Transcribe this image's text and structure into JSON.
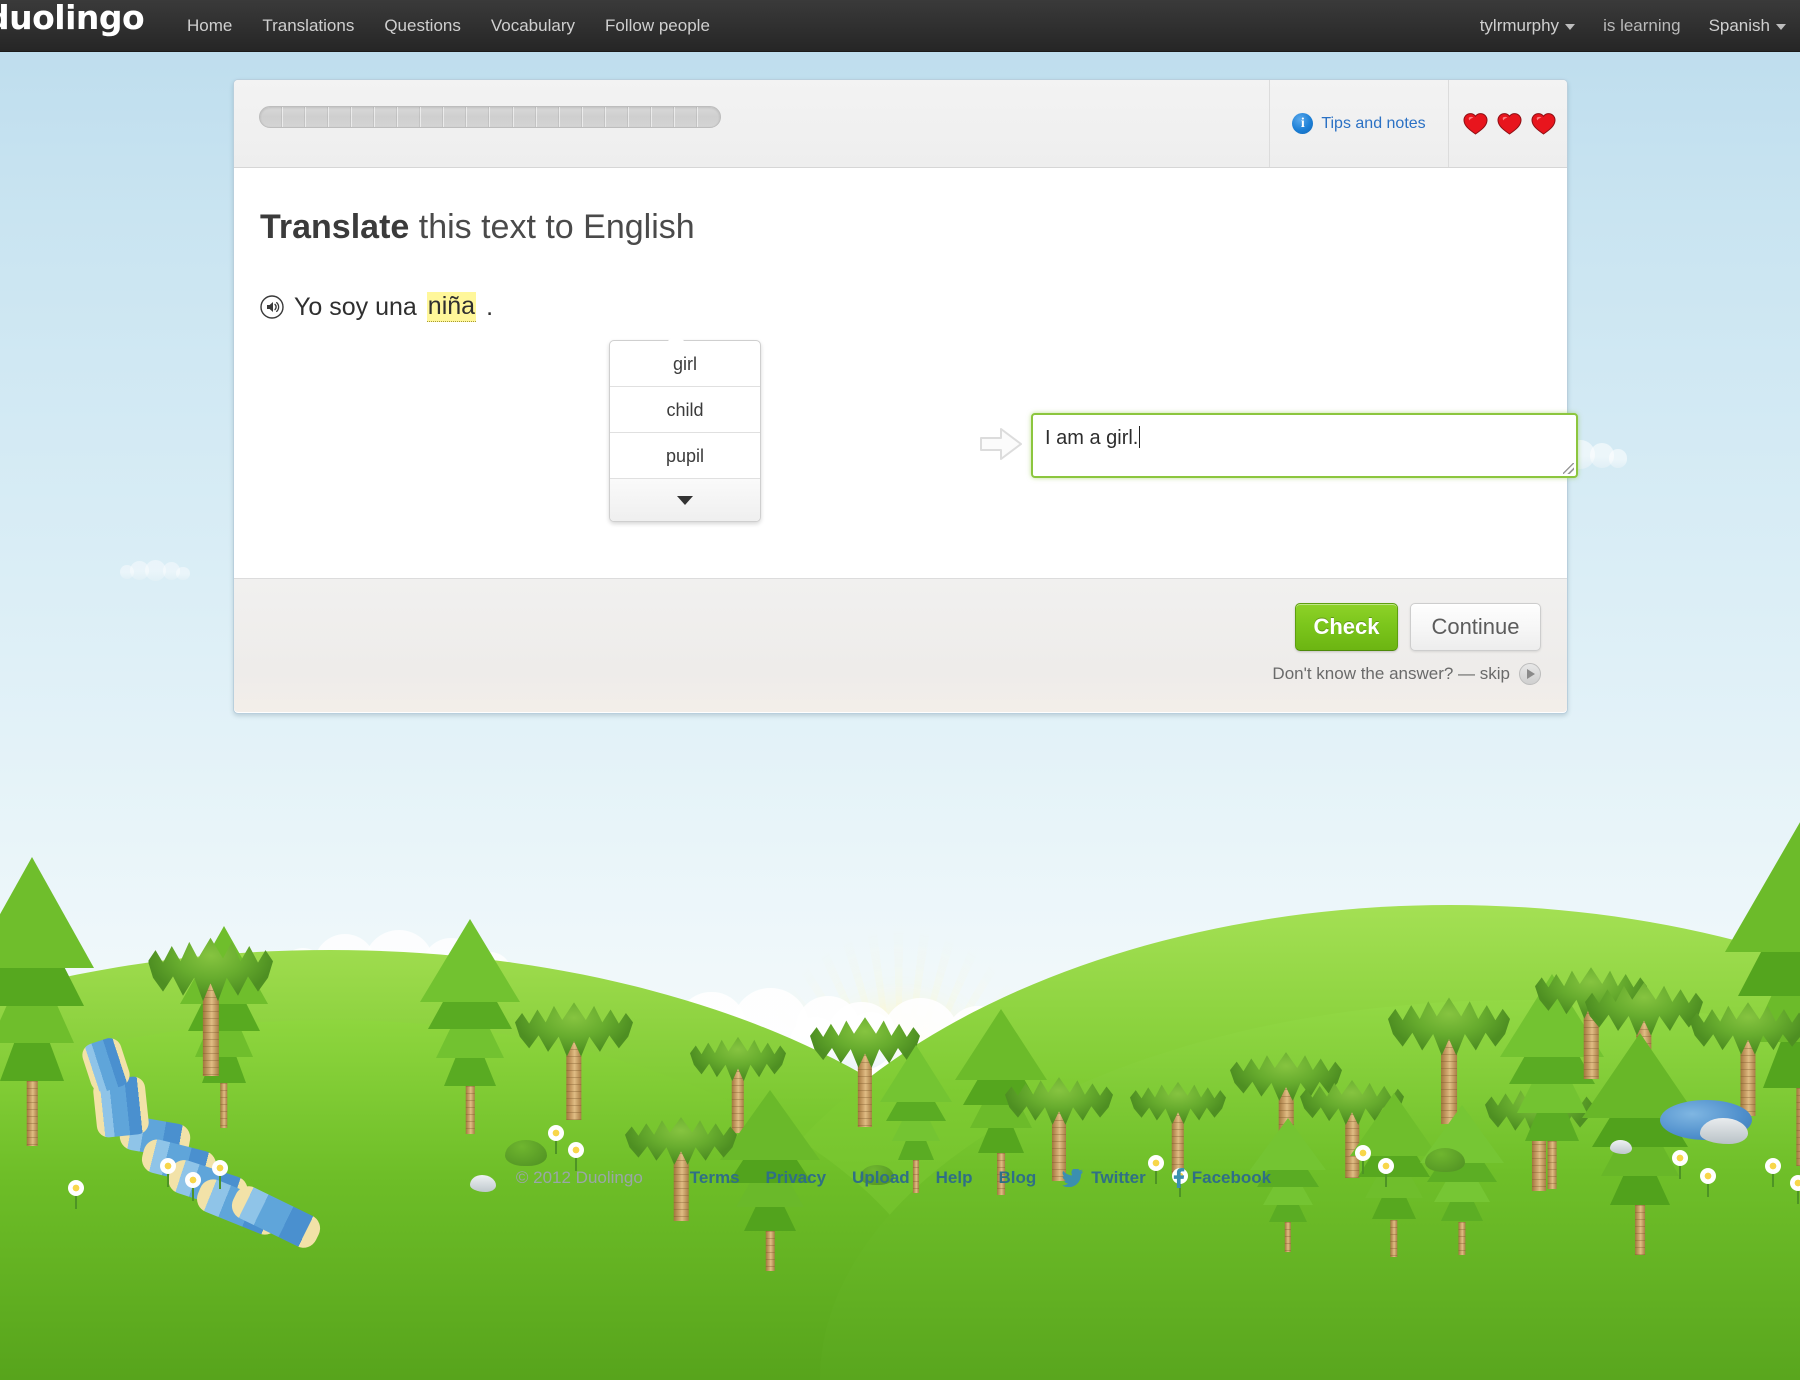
{
  "nav": {
    "brand": "duolingo",
    "links": [
      "Home",
      "Translations",
      "Questions",
      "Vocabulary",
      "Follow people"
    ],
    "username": "tylrmurphy",
    "is_learning_label": "is learning",
    "language": "Spanish"
  },
  "card": {
    "tips_label": "Tips and notes",
    "hearts": 3,
    "progress_segments": 20,
    "progress_filled": 0,
    "prompt_bold": "Translate",
    "prompt_rest": " this text to English",
    "sentence": {
      "before": "Yo soy una ",
      "hint_word": "niña",
      "after": "."
    },
    "hints": [
      "girl",
      "child",
      "pupil"
    ],
    "answer_value": "I am a girl.",
    "check_label": "Check",
    "continue_label": "Continue",
    "skip_text": "Don't know the answer? — skip"
  },
  "footer": {
    "copyright": "© 2012 Duolingo",
    "links": [
      "Terms",
      "Privacy",
      "Upload",
      "Help",
      "Blog"
    ],
    "twitter": "Twitter",
    "facebook": "Facebook"
  },
  "colors": {
    "accent_green": "#7cc61c",
    "link_blue": "#2b71c4",
    "highlight_yellow": "#fff79a",
    "heart_red": "#e8151d",
    "nav_bg": "#2e2e2e",
    "sky_top": "#bcdced"
  }
}
